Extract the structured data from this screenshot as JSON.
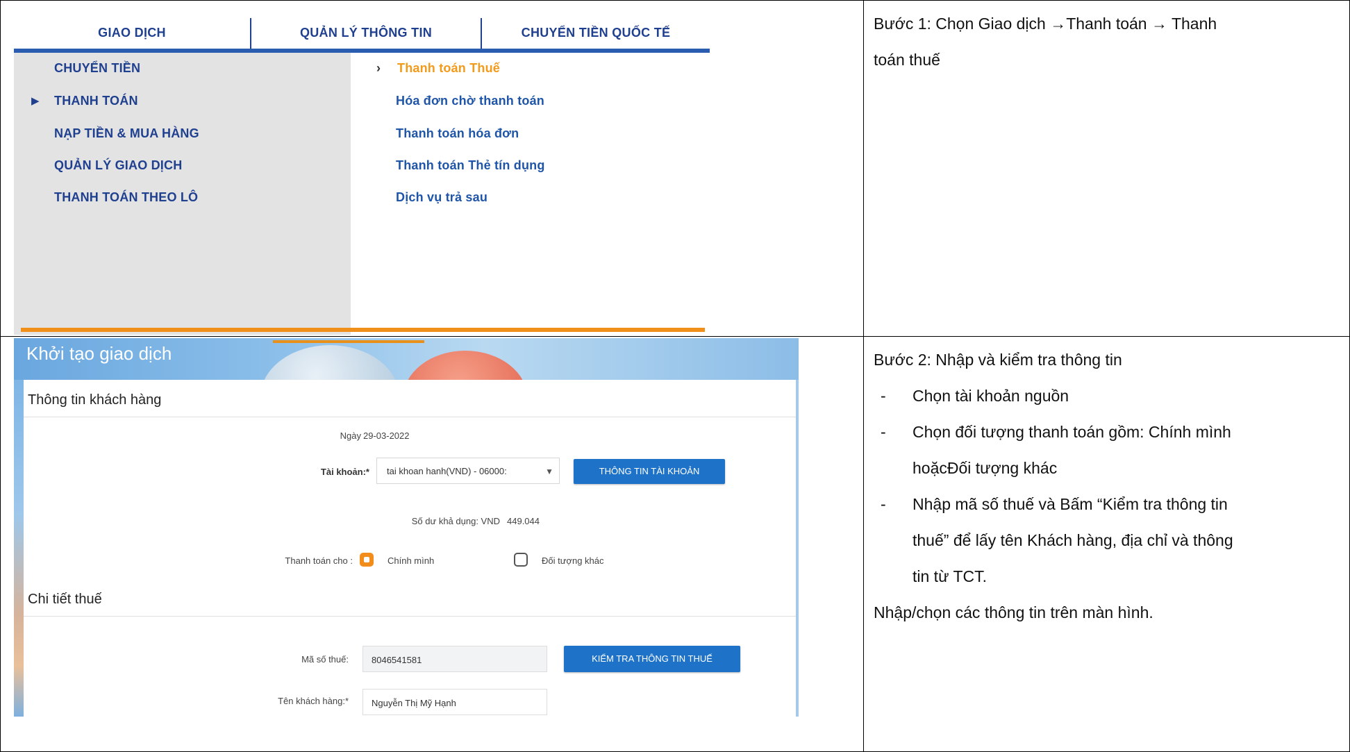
{
  "step1": {
    "menu": {
      "tabs": [
        "GIAO DỊCH",
        "QUẢN LÝ THÔNG TIN",
        "CHUYỂN TIỀN QUỐC TẾ"
      ],
      "left_items": [
        "CHUYỂN TIỀN",
        "THANH TOÁN",
        "NẠP TIỀN & MUA HÀNG",
        "QUẢN LÝ GIAO DỊCH",
        "THANH TOÁN THEO LÔ"
      ],
      "left_selected": "THANH TOÁN",
      "right_items": [
        "Thanh toán Thuế",
        "Hóa đơn chờ thanh toán",
        "Thanh toán hóa đơn",
        "Thanh toán Thẻ tín dụng",
        "Dịch vụ trả sau"
      ],
      "right_selected": "Thanh toán Thuế",
      "colors": {
        "nav_text": "#1f3f8f",
        "active": "#f39a1b",
        "accent": "#f0901a"
      }
    },
    "description": {
      "line1": "Bước 1: Chọn Giao dịch →Thanh toán → Thanh",
      "line2": "toán thuế"
    }
  },
  "step2": {
    "form": {
      "title": "Khởi tạo giao dịch",
      "section_customer": "Thông tin khách hàng",
      "date_label": "Ngày",
      "date_value": "29-03-2022",
      "account_label": "Tài khoản:*",
      "account_value": "tai khoan hanh(VND) - 06000:",
      "account_button": "THÔNG TIN TÀI KHOẢN",
      "balance_label": "Số dư khả dụng: VND",
      "balance_value": "449.044",
      "pay_for_label": "Thanh toán cho :",
      "option_self": "Chính mình",
      "option_other": "Đối tượng khác",
      "selected_option": "Chính mình",
      "section_tax": "Chi tiết thuế",
      "tax_code_label": "Mã số thuế:",
      "tax_code_value": "8046541581",
      "check_tax_button": "KIỂM TRA THÔNG TIN THUẾ",
      "customer_name_label": "Tên khách hàng:*",
      "customer_name_value": "Nguyễn Thị Mỹ Hạnh",
      "colors": {
        "button": "#1e73c9",
        "radio_on": "#f28c1b"
      }
    },
    "description": {
      "title": "Bước 2: Nhập và kiểm tra thông tin",
      "bullets": [
        "Chọn tài khoản nguồn",
        "Chọn đối tượng thanh toán gồm: Chính mình",
        "hoặcĐối tượng khác",
        "Nhập mã số thuế và Bấm “Kiểm tra thông tin",
        "thuế” để lấy tên Khách hàng, địa chỉ và thông",
        "tin từ TCT."
      ],
      "footer": "Nhập/chọn các thông tin trên màn hình."
    }
  }
}
